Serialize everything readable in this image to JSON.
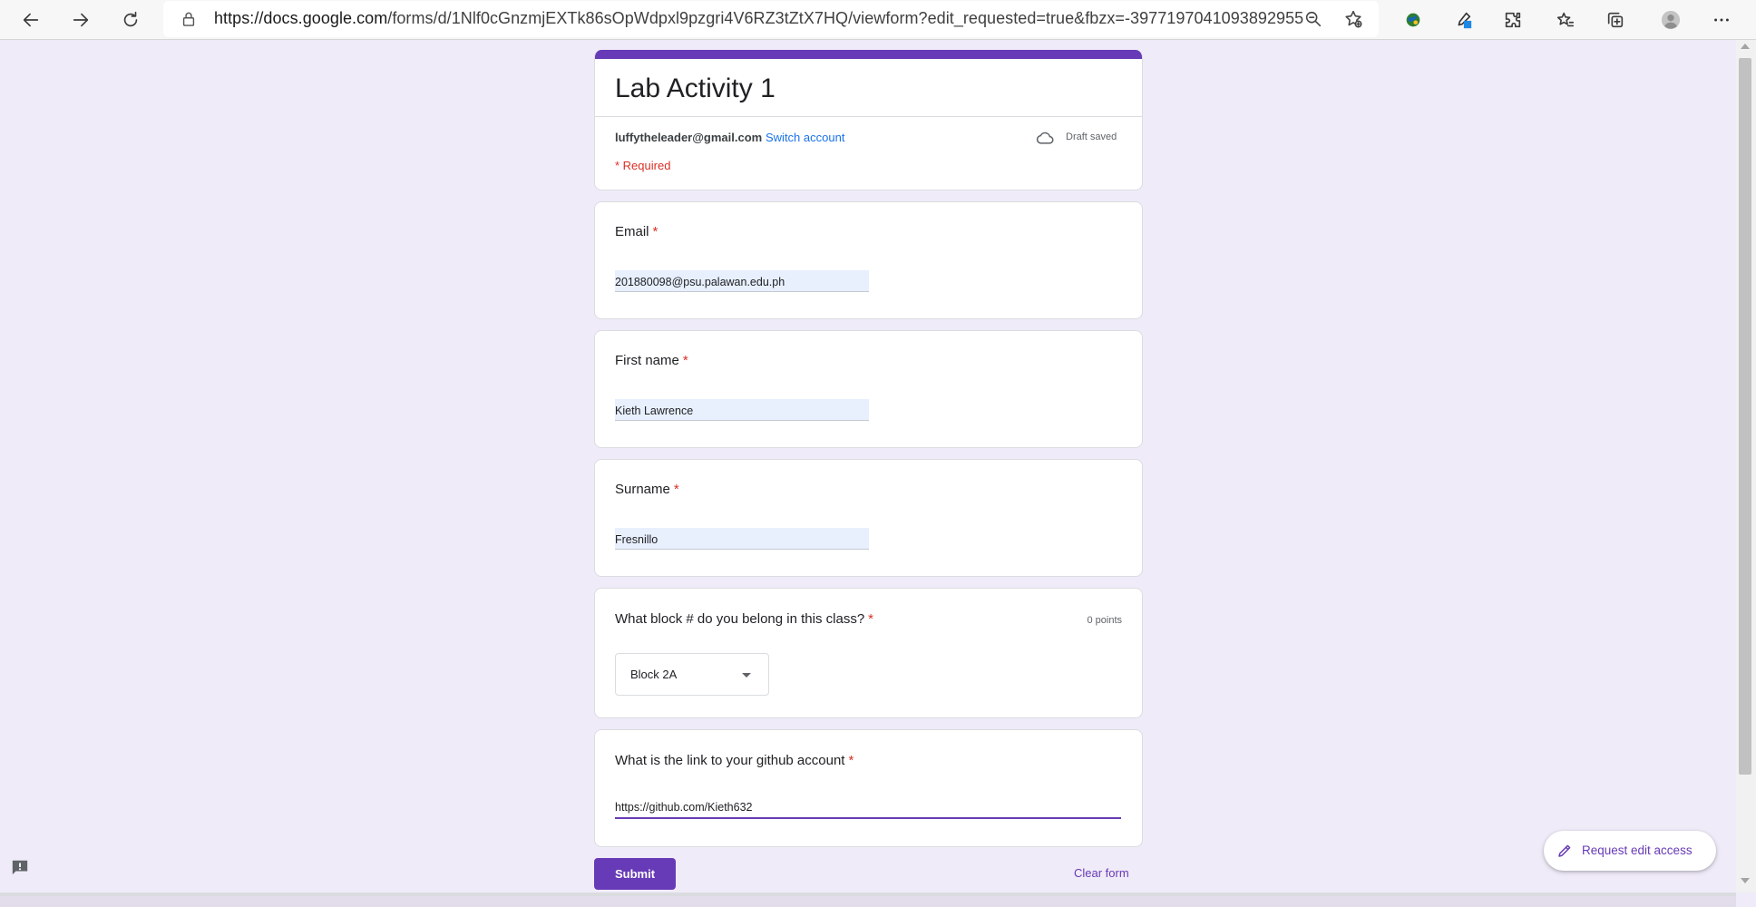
{
  "browser": {
    "url_prefix": "https://docs.google.com",
    "url_path": "/forms/d/1Nlf0cGnzmjEXTk86sOpWdpxl9pzgri4V6RZ3tZtX7HQ/viewform?edit_requested=true&fbzx=-3977197041093892955",
    "icons": [
      "back-icon",
      "forward-icon",
      "refresh-icon",
      "lock-icon",
      "zoom-out-icon",
      "add-favorite-icon",
      "extension-globe-icon",
      "eyedropper-icon",
      "extensions-icon",
      "favorites-icon",
      "collections-icon",
      "profile-icon",
      "more-icon"
    ]
  },
  "form": {
    "title": "Lab Activity 1",
    "account_email": "luffytheleader@gmail.com",
    "switch_account": "Switch account",
    "draft_status": "Draft saved",
    "required_note": "* Required",
    "required_marker": "*",
    "questions": {
      "email": {
        "label": "Email",
        "value": "201880098@psu.palawan.edu.ph"
      },
      "first_name": {
        "label": "First name",
        "value": "Kieth Lawrence"
      },
      "surname": {
        "label": "Surname",
        "value": "Fresnillo"
      },
      "block": {
        "label": "What block # do you belong in this class?",
        "points": "0 points",
        "selected": "Block 2A"
      },
      "github": {
        "label": "What is the link to your github account",
        "value": "https://github.com/Kieth632"
      }
    },
    "submit_label": "Submit",
    "clear_label": "Clear form"
  },
  "request_edit": {
    "label": "Request edit access"
  },
  "colors": {
    "accent": "#673ab7",
    "background": "#f0ebf8",
    "required": "#d93025",
    "link": "#1a73e8"
  }
}
